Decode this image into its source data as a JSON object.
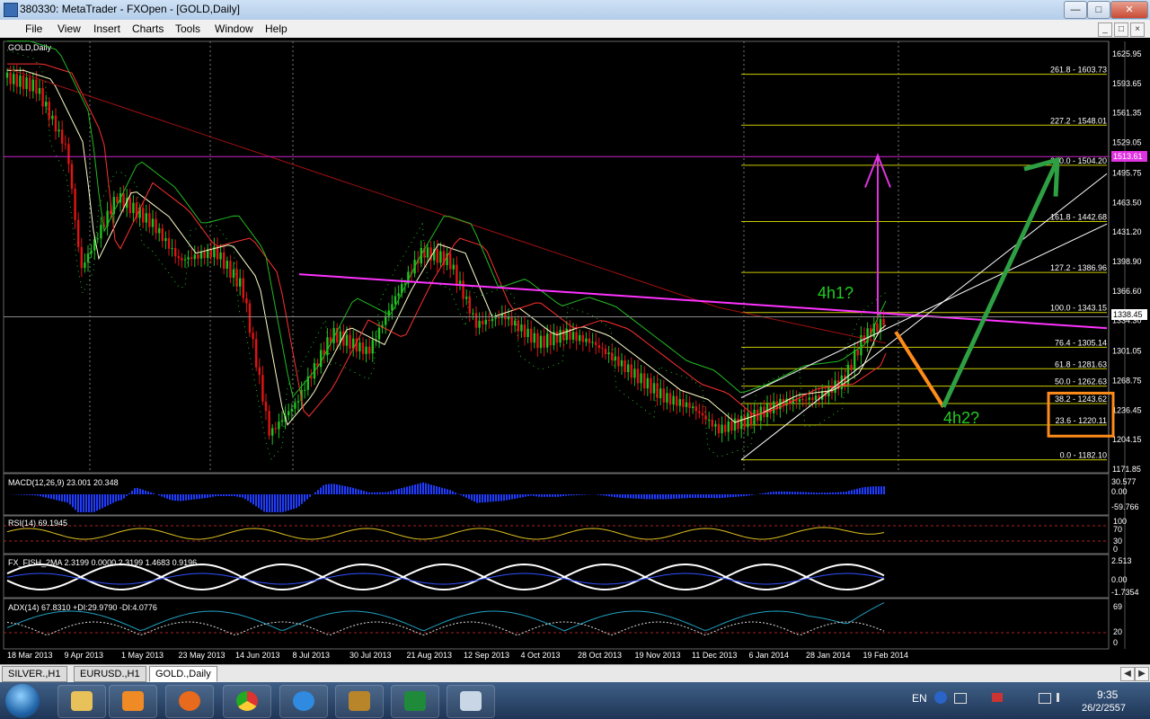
{
  "window": {
    "title": "380330: MetaTrader - FXOpen - [GOLD,Daily]"
  },
  "menu": [
    "File",
    "View",
    "Insert",
    "Charts",
    "Tools",
    "Window",
    "Help"
  ],
  "chart": {
    "symbol_label": "GOLD,Daily",
    "current_price": "1338.45",
    "resistance_label": "1513.61",
    "price_scale": [
      "1625.95",
      "1593.65",
      "1561.35",
      "1529.05",
      "1495.75",
      "1463.50",
      "1431.20",
      "1398.90",
      "1366.60",
      "1334.30",
      "1301.05",
      "1268.75",
      "1236.45",
      "1204.15",
      "1171.85"
    ],
    "time_labels": [
      "18 Mar 2013",
      "9 Apr 2013",
      "1 May 2013",
      "23 May 2013",
      "14 Jun 2013",
      "8 Jul 2013",
      "30 Jul 2013",
      "21 Aug 2013",
      "12 Sep 2013",
      "4 Oct 2013",
      "28 Oct 2013",
      "19 Nov 2013",
      "11 Dec 2013",
      "6 Jan 2014",
      "28 Jan 2014",
      "19 Feb 2014"
    ],
    "fib_levels": [
      {
        "label": "261.8 - 1603.73"
      },
      {
        "label": "227.2 - 1548.01"
      },
      {
        "label": "200.0 - 1504.20"
      },
      {
        "label": "161.8 - 1442.68"
      },
      {
        "label": "127.2 - 1386.96"
      },
      {
        "label": "100.0 - 1343.15"
      },
      {
        "label": "76.4 - 1305.14"
      },
      {
        "label": "61.8 - 1281.63"
      },
      {
        "label": "50.0 - 1262.63"
      },
      {
        "label": "38.2 - 1243.62"
      },
      {
        "label": "23.6 - 1220.11"
      },
      {
        "label": "0.0 - 1182.10"
      }
    ],
    "annotations": {
      "scenario1": "4h1?",
      "scenario2": "4h2?"
    },
    "indicators": {
      "macd": {
        "label": "MACD(12,26,9) 23.001 20.348",
        "scale": [
          "30.577",
          "0.00",
          "-59.766"
        ]
      },
      "rsi": {
        "label": "RSI(14) 69.1945",
        "scale": [
          "100",
          "70",
          "30",
          "0"
        ]
      },
      "fish": {
        "label": "FX_FISH_2MA 2.3199 0.0000 2.3199 1.4683 0.9196",
        "scale": [
          "2.513",
          "0.00",
          "-1.7354"
        ]
      },
      "adx": {
        "label": "ADX(14) 67.8310 +DI:29.9790 -DI:4.0776",
        "scale": [
          "69",
          "20",
          "0"
        ]
      }
    },
    "colors": {
      "up": "#22c022",
      "down": "#e01414",
      "trend": "#ff33ff",
      "fib": "#cccc00",
      "box": "#ff8c1a",
      "arrow_up": "#2ea043"
    }
  },
  "tabs": [
    {
      "label": "SILVER.,H1",
      "active": false
    },
    {
      "label": "EURUSD.,H1",
      "active": false
    },
    {
      "label": "GOLD.,Daily",
      "active": true
    }
  ],
  "taskbar": {
    "apps": [
      "windows-explorer",
      "media-player",
      "firefox",
      "chrome",
      "internet-explorer",
      "metatrader",
      "excel",
      "paint"
    ],
    "language": "EN",
    "time": "9:35",
    "date": "26/2/2557"
  }
}
